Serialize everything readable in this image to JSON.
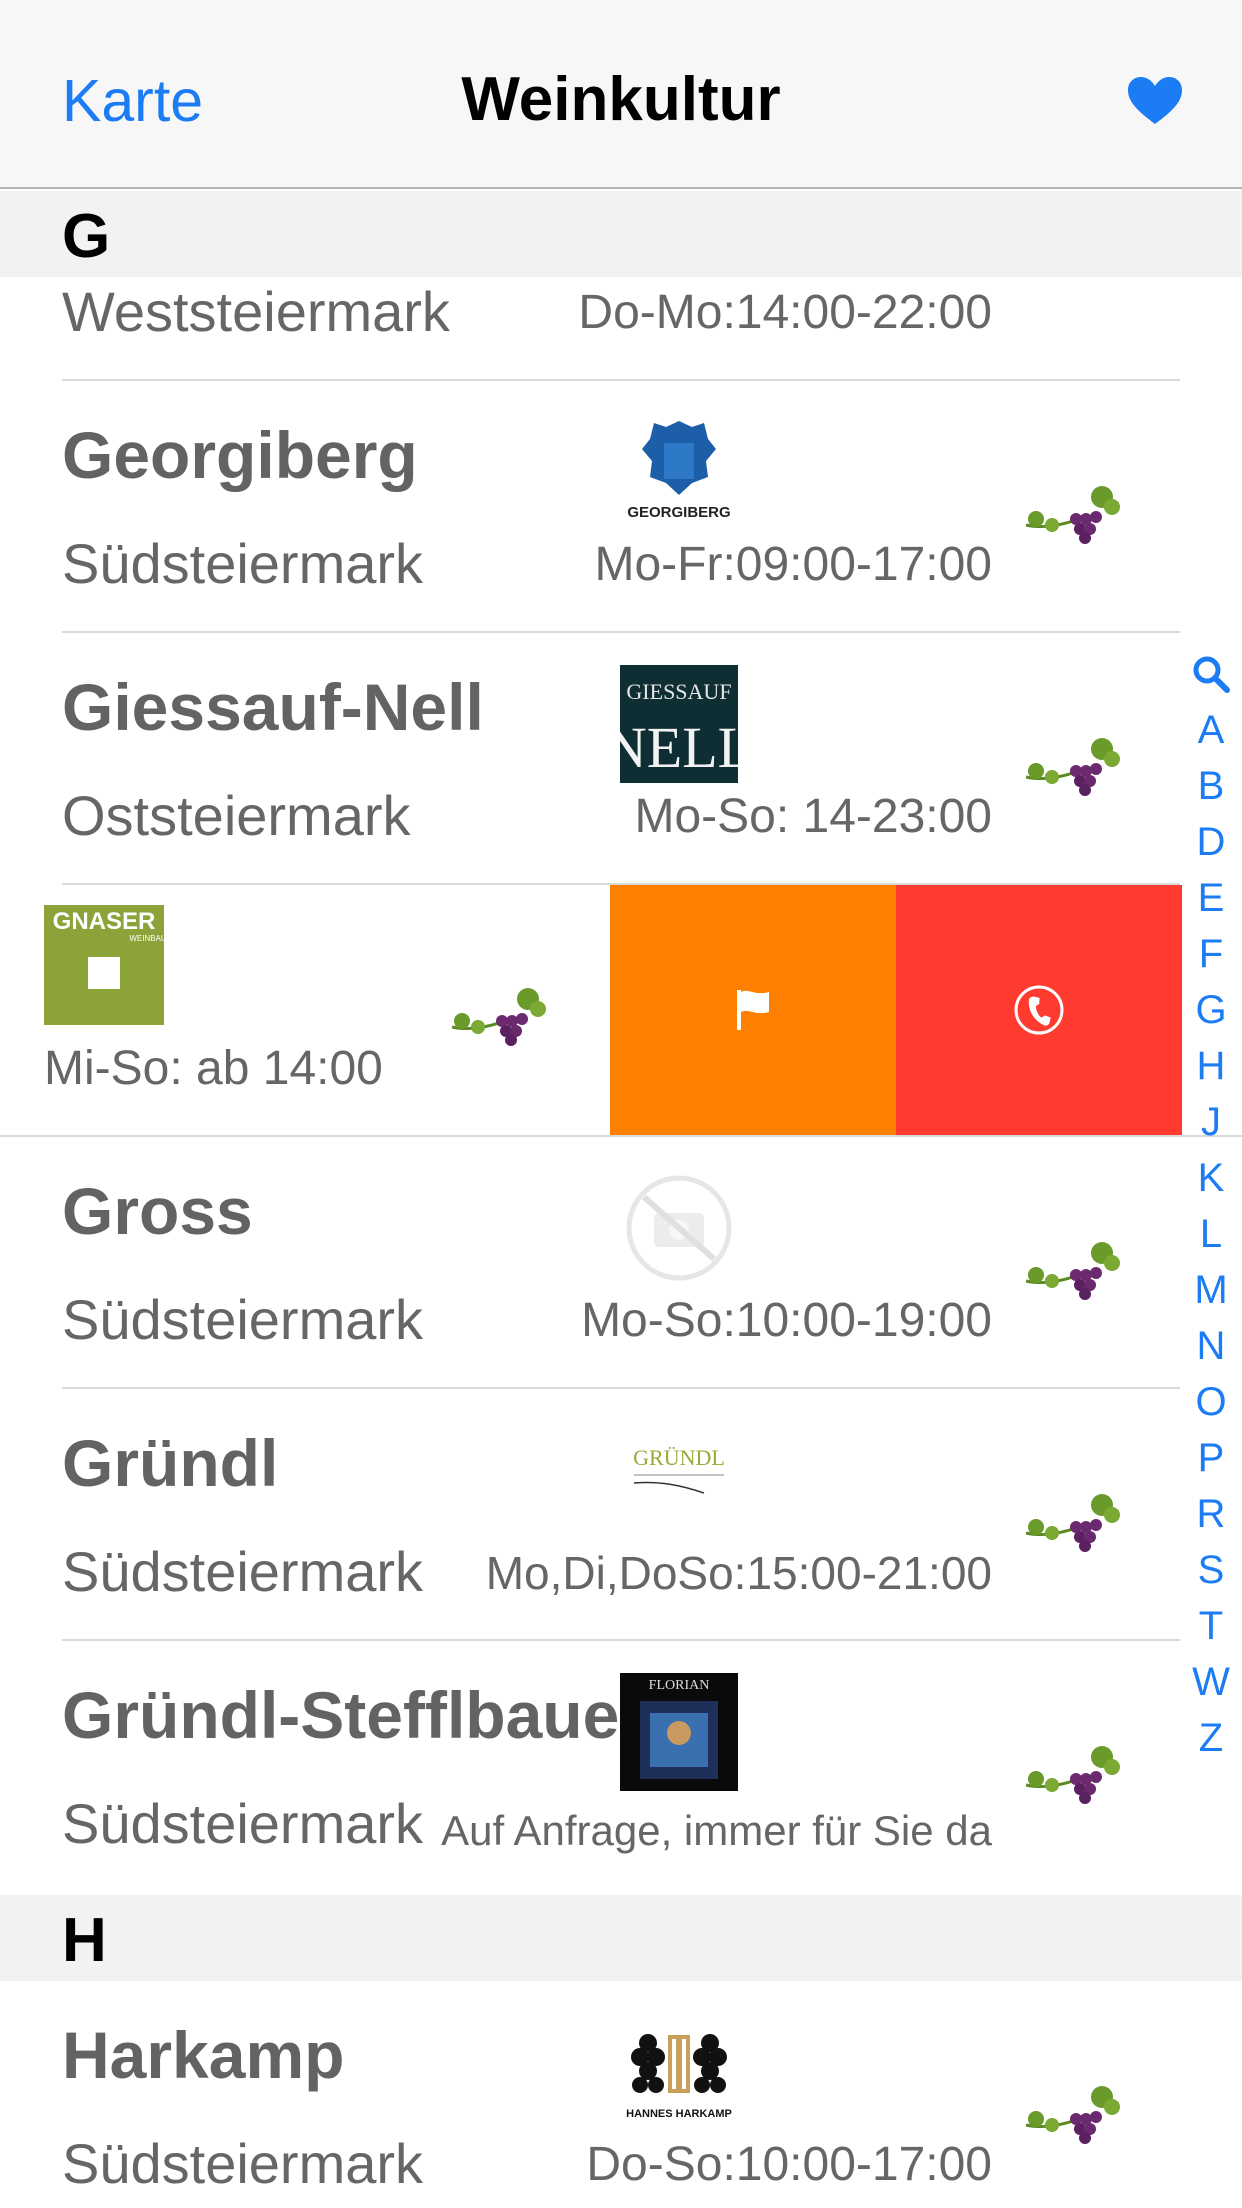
{
  "nav": {
    "back_label": "Karte",
    "title": "Weinkultur",
    "favorites_icon": "heart-icon",
    "accent": "#1c7cf4"
  },
  "sections": [
    {
      "letter": "G",
      "partial_row": {
        "region": "Weststeiermark",
        "hours": "Do-Mo:14:00-22:00"
      },
      "rows": [
        {
          "name": "Georgiberg",
          "region": "Südsteiermark",
          "hours": "Mo-Fr:09:00-17:00",
          "logo_text": "GEORGIBERG"
        },
        {
          "name": "Giessauf-Nell",
          "region": "Oststeiermark",
          "hours": "Mo-So: 14-23:00",
          "logo_text_top": "GIESSAUF",
          "logo_text_bottom": "NELL"
        },
        {
          "name": "Gross",
          "region": "Südsteiermark",
          "hours": "Mo-So:10:00-19:00"
        },
        {
          "name": "Gründl",
          "region": "Südsteiermark",
          "hours": "Mo,Di,DoSo:15:00-21:00",
          "logo_text": "GRÜNDL"
        },
        {
          "name": "Gründl-Stefflbauer",
          "region": "Südsteiermark",
          "hours": "Auf Anfrage, immer für Sie da",
          "logo_text": "FLORIAN"
        }
      ],
      "swiped_row": {
        "hours": "Mi-So: ab 14:00",
        "logo_text": "GNASER",
        "logo_subtext": "WEINBAU",
        "actions": [
          {
            "icon": "flag-icon",
            "color": "#ff7f00"
          },
          {
            "icon": "phone-icon",
            "color": "#ff3b30"
          }
        ]
      }
    },
    {
      "letter": "H",
      "rows": [
        {
          "name": "Harkamp",
          "region": "Südsteiermark",
          "hours": "Do-So:10:00-17:00",
          "logo_text": "HANNES HARKAMP"
        }
      ]
    }
  ],
  "index": [
    "A",
    "B",
    "D",
    "E",
    "F",
    "G",
    "H",
    "J",
    "K",
    "L",
    "M",
    "N",
    "O",
    "P",
    "R",
    "S",
    "T",
    "W",
    "Z"
  ],
  "colors": {
    "swipe_flag": "#ff7f00",
    "swipe_call": "#ff3b30",
    "grape_leaf": "#6a9a2a",
    "grape_fruit": "#6b2a6e"
  }
}
